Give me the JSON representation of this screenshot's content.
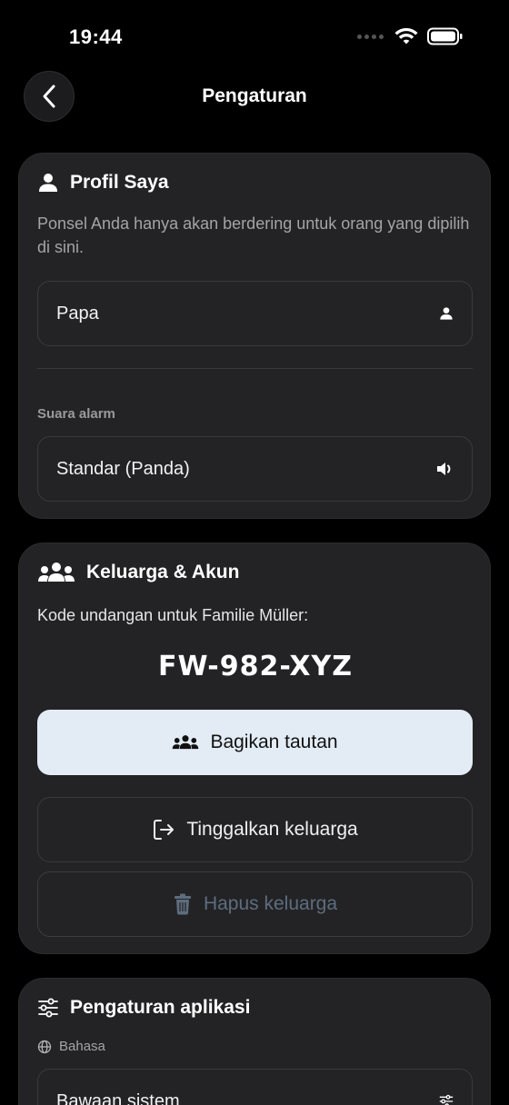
{
  "status": {
    "time": "19:44"
  },
  "nav": {
    "title": "Pengaturan"
  },
  "profile": {
    "title": "Profil Saya",
    "description": "Ponsel Anda hanya akan berdering untuk orang yang dipilih di sini.",
    "name_value": "Papa",
    "alarm_label": "Suara alarm",
    "alarm_value": "Standar (Panda)"
  },
  "family": {
    "title": "Keluarga & Akun",
    "invite_text": "Kode undangan untuk Familie Müller:",
    "invite_code": "FW-982-XYZ",
    "share_label": "Bagikan tautan",
    "leave_label": "Tinggalkan keluarga",
    "delete_label": "Hapus keluarga"
  },
  "app_settings": {
    "title": "Pengaturan aplikasi",
    "language_label": "Bahasa",
    "language_value": "Bawaan sistem"
  },
  "colors": {
    "background": "#000000",
    "card": "#232325",
    "primary_button": "#e3ecf5",
    "disabled_text": "#5d6d7f"
  }
}
